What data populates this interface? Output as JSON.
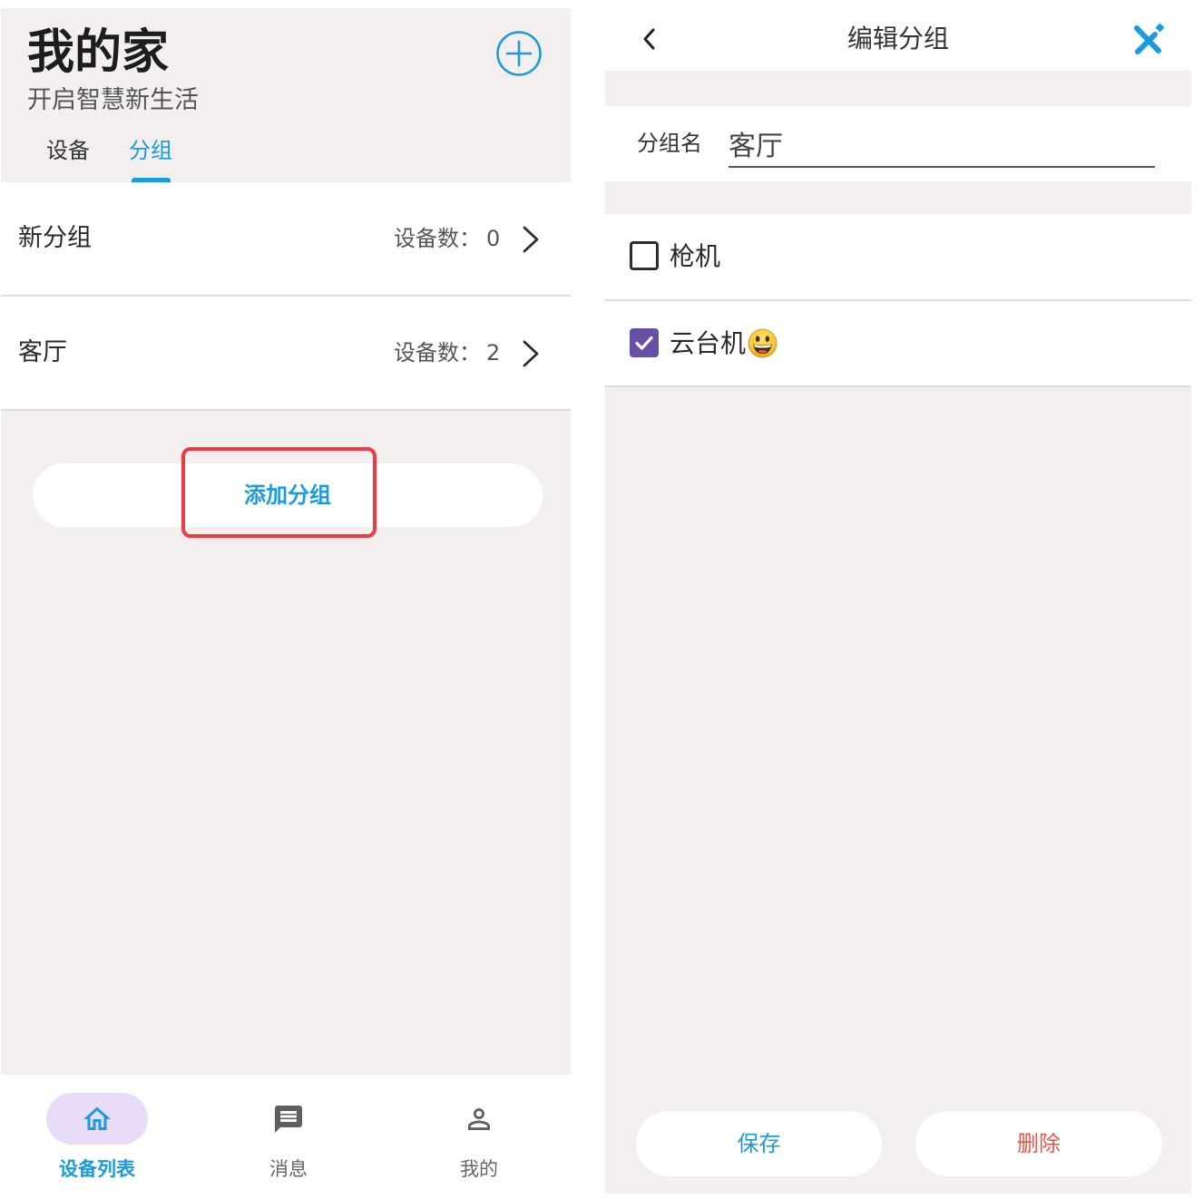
{
  "colors": {
    "accent": "#1a9be0",
    "danger": "#e8574b",
    "checkbox_checked": "#6750a4",
    "highlight_border": "#ef3a45",
    "panel_bg": "#f3efef",
    "nav_active_pill": "#e8dcf8"
  },
  "home": {
    "header": {
      "title": "我的家",
      "subtitle": "开启智慧新生活",
      "add_icon": "add-circle-icon"
    },
    "tabs": [
      {
        "label": "设备",
        "active": false
      },
      {
        "label": "分组",
        "active": true
      }
    ],
    "groups": [
      {
        "name": "新分组",
        "count_label": "设备数：",
        "count": "0"
      },
      {
        "name": "客厅",
        "count_label": "设备数：",
        "count": "2"
      }
    ],
    "add_group_button": "添加分组",
    "bottom_nav": [
      {
        "label": "设备列表",
        "icon": "home-icon",
        "active": true
      },
      {
        "label": "消息",
        "icon": "message-icon",
        "active": false
      },
      {
        "label": "我的",
        "icon": "person-icon",
        "active": false
      }
    ]
  },
  "edit_group": {
    "title": "编辑分组",
    "back_icon": "chevron-left-icon",
    "action_icon": "tools-icon",
    "name_label": "分组名",
    "name_value": "客厅",
    "devices": [
      {
        "name": "枪机",
        "checked": false
      },
      {
        "name": "云台机",
        "emoji_icon": "grinning-face-icon",
        "checked": true
      }
    ],
    "save_button": "保存",
    "delete_button": "删除"
  }
}
